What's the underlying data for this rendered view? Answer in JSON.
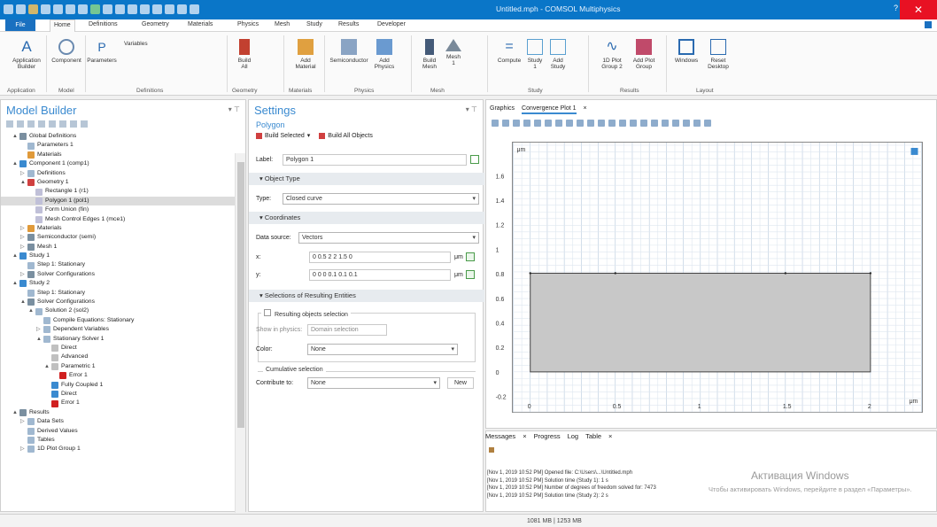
{
  "window": {
    "title": "Untitled.mph - COMSOL Multiphysics",
    "help": "?",
    "close": "✕"
  },
  "ribbon_tabs": [
    "File",
    "Home",
    "Definitions",
    "Geometry",
    "Materials",
    "Physics",
    "Mesh",
    "Study",
    "Results",
    "Developer"
  ],
  "ribbon": {
    "buttons": [
      {
        "label": "Application\nBuilder",
        "icon": "app-builder-icon"
      },
      {
        "label": "Component",
        "icon": "component-icon"
      },
      {
        "label": "Parameters",
        "icon": "parameters-icon"
      },
      {
        "label": "Variables",
        "icon": "variables-icon"
      },
      {
        "label": "Build\nAll",
        "icon": "build-all-icon"
      },
      {
        "label": "Add\nMaterial",
        "icon": "add-material-icon"
      },
      {
        "label": "Semiconductor",
        "icon": "semiconductor-icon"
      },
      {
        "label": "Add\nPhysics",
        "icon": "add-physics-icon"
      },
      {
        "label": "Build\nMesh",
        "icon": "build-mesh-icon"
      },
      {
        "label": "Mesh\n1",
        "icon": "mesh-icon"
      },
      {
        "label": "Compute",
        "icon": "compute-icon"
      },
      {
        "label": "Study\n1",
        "icon": "study-icon"
      },
      {
        "label": "Add\nStudy",
        "icon": "add-study-icon"
      },
      {
        "label": "1D Plot\nGroup 2",
        "icon": "plot-icon"
      },
      {
        "label": "Add Plot\nGroup",
        "icon": "add-plot-icon"
      },
      {
        "label": "Windows",
        "icon": "windows-icon"
      },
      {
        "label": "Reset\nDesktop",
        "icon": "reset-desktop-icon"
      }
    ],
    "groups": [
      "Application",
      "Model",
      "Definitions",
      "Geometry",
      "Materials",
      "Physics",
      "Mesh",
      "Study",
      "Results",
      "Layout"
    ]
  },
  "model_builder": {
    "title": "Model Builder",
    "tree": [
      {
        "label": "Global Definitions",
        "indent": 1,
        "exp": "▲",
        "color": "#7a8fa0"
      },
      {
        "label": "Parameters 1",
        "indent": 2,
        "exp": "",
        "color": "#a0b8d0"
      },
      {
        "label": "Materials",
        "indent": 2,
        "exp": "",
        "color": "#e09a3a"
      },
      {
        "label": "Component 1 (comp1)",
        "indent": 1,
        "exp": "▲",
        "color": "#3a8ad0"
      },
      {
        "label": "Definitions",
        "indent": 2,
        "exp": "▷",
        "color": "#a0b8d0"
      },
      {
        "label": "Geometry 1",
        "indent": 2,
        "exp": "▲",
        "color": "#d04040"
      },
      {
        "label": "Rectangle 1 (r1)",
        "indent": 3,
        "exp": "",
        "color": "#c0c0d8"
      },
      {
        "label": "Polygon 1 (pol1)",
        "indent": 3,
        "exp": "",
        "color": "#c0c0d8",
        "selected": true
      },
      {
        "label": "Form Union (fin)",
        "indent": 3,
        "exp": "",
        "color": "#c0c0d8"
      },
      {
        "label": "Mesh Control Edges 1 (mce1)",
        "indent": 3,
        "exp": "",
        "color": "#c0c0d8"
      },
      {
        "label": "Materials",
        "indent": 2,
        "exp": "▷",
        "color": "#e09a3a"
      },
      {
        "label": "Semiconductor (semi)",
        "indent": 2,
        "exp": "▷",
        "color": "#7a8fa0"
      },
      {
        "label": "Mesh 1",
        "indent": 2,
        "exp": "▷",
        "color": "#7a8fa0"
      },
      {
        "label": "Study 1",
        "indent": 1,
        "exp": "▲",
        "color": "#3a8ad0"
      },
      {
        "label": "Step 1: Stationary",
        "indent": 2,
        "exp": "",
        "color": "#a0b8d0"
      },
      {
        "label": "Solver Configurations",
        "indent": 2,
        "exp": "▷",
        "color": "#7a8fa0"
      },
      {
        "label": "Study 2",
        "indent": 1,
        "exp": "▲",
        "color": "#3a8ad0"
      },
      {
        "label": "Step 1: Stationary",
        "indent": 2,
        "exp": "",
        "color": "#a0b8d0"
      },
      {
        "label": "Solver Configurations",
        "indent": 2,
        "exp": "▲",
        "color": "#7a8fa0"
      },
      {
        "label": "Solution 2 (sol2)",
        "indent": 3,
        "exp": "▲",
        "color": "#a0b8d0"
      },
      {
        "label": "Compile Equations: Stationary",
        "indent": 4,
        "exp": "",
        "color": "#a0b8d0"
      },
      {
        "label": "Dependent Variables",
        "indent": 4,
        "exp": "▷",
        "color": "#a0b8d0"
      },
      {
        "label": "Stationary Solver 1",
        "indent": 4,
        "exp": "▲",
        "color": "#a0b8d0"
      },
      {
        "label": "Direct",
        "indent": 5,
        "exp": "",
        "color": "#c0c0c0"
      },
      {
        "label": "Advanced",
        "indent": 5,
        "exp": "",
        "color": "#c0c0c0"
      },
      {
        "label": "Parametric 1",
        "indent": 5,
        "exp": "▲",
        "color": "#c0c0c0"
      },
      {
        "label": "Error 1",
        "indent": 6,
        "exp": "",
        "color": "#d02020"
      },
      {
        "label": "Fully Coupled 1",
        "indent": 5,
        "exp": "",
        "color": "#3a8ad0"
      },
      {
        "label": "Direct",
        "indent": 5,
        "exp": "",
        "color": "#3a8ad0"
      },
      {
        "label": "Error 1",
        "indent": 5,
        "exp": "",
        "color": "#d02020"
      },
      {
        "label": "Results",
        "indent": 1,
        "exp": "▲",
        "color": "#7a8fa0"
      },
      {
        "label": "Data Sets",
        "indent": 2,
        "exp": "▷",
        "color": "#a0b8d0"
      },
      {
        "label": "Derived Values",
        "indent": 2,
        "exp": "",
        "color": "#a0b8d0"
      },
      {
        "label": "Tables",
        "indent": 2,
        "exp": "",
        "color": "#a0b8d0"
      },
      {
        "label": "1D Plot Group 1",
        "indent": 2,
        "exp": "▷",
        "color": "#a0b8d0"
      }
    ]
  },
  "settings": {
    "title": "Settings",
    "subtitle": "Polygon",
    "build_selected": "Build Selected",
    "build_all": "Build All Objects",
    "label_field_label": "Label:",
    "label_value": "Polygon 1",
    "sections": {
      "object_type": "Object Type",
      "coordinates": "Coordinates",
      "selections": "Selections of Resulting Entities"
    },
    "type_label": "Type:",
    "type_value": "Closed curve",
    "data_source_label": "Data source:",
    "data_source_value": "Vectors",
    "x_label": "x:",
    "x_value": "0 0.5 2 2 1.5 0",
    "y_label": "y:",
    "y_value": "0 0 0 0.1 0.1 0.1",
    "unit": "μm",
    "resulting_legend": "Resulting objects selection",
    "show_in_physics_label": "Show in physics:",
    "show_in_physics_value": "Domain selection",
    "color_label": "Color:",
    "color_value": "None",
    "cumulative_legend": "Cumulative selection",
    "contribute_label": "Contribute to:",
    "contribute_value": "None",
    "new_button": "New"
  },
  "graphics": {
    "tabs": [
      "Graphics",
      "Convergence Plot 1"
    ],
    "x_ticks": [
      "0",
      "0.5",
      "1",
      "1.5",
      "2"
    ],
    "y_ticks": [
      "1.6",
      "1.4",
      "1.2",
      "1",
      "0.8",
      "0.6",
      "0.4",
      "0.2",
      "0",
      "-0.2"
    ],
    "y_unit": "μm",
    "x_unit": "μm",
    "axis": {
      "xmin": -0.1,
      "xmax": 2.3,
      "ymin": -0.3,
      "ymax": 1.72
    },
    "polygon": {
      "x": [
        0,
        2,
        2,
        0
      ],
      "y": [
        0,
        0,
        0.1,
        0.1
      ]
    }
  },
  "messages": {
    "tabs": [
      "Messages",
      "Progress",
      "Log",
      "Table"
    ],
    "lines": [
      "[Nov 1, 2019 10:52 PM] Opened file: C:\\Users\\...\\Untitled.mph",
      "[Nov 1, 2019 10:52 PM] Solution time (Study 1): 1 s",
      "[Nov 1, 2019 10:52 PM] Number of degrees of freedom solved for: 7473",
      "[Nov 1, 2019 10:52 PM] Solution time (Study 2): 2 s"
    ],
    "watermark": "Активация Windows",
    "watermark_sub": "Чтобы активировать Windows, перейдите в раздел «Параметры»."
  },
  "status": {
    "memory": "1081 MB | 1253 MB"
  }
}
